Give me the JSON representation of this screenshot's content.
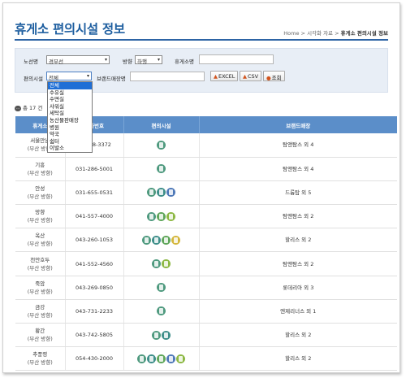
{
  "page": {
    "title": "휴게소 편의시설 정보",
    "breadcrumb": [
      "Home",
      "시각화 자료",
      "휴게소 편의시설 정보"
    ],
    "breadcrumb_sep": ">"
  },
  "search": {
    "route_label": "노선명",
    "route_value": "경부선",
    "direction_label": "방향",
    "direction_value": "하행",
    "rest_label": "휴게소명",
    "facility_label": "편의시설",
    "facility_value": "전체",
    "brand_label": "브랜드매장명",
    "excel": "EXCEL",
    "csv": "CSV",
    "search_btn": "조회",
    "arrow": "▾"
  },
  "dropdown": {
    "options": [
      "전체",
      "수유실",
      "수면실",
      "샤워실",
      "세탁실",
      "농산물판매장",
      "병원",
      "약국",
      "쉼터",
      "이발소"
    ],
    "selected": 0
  },
  "count": {
    "text": "총 17 건"
  },
  "table": {
    "headers": [
      "휴게소",
      "전화번호",
      "편의시설",
      "브랜드매장"
    ],
    "rows": [
      {
        "name": "서울만남",
        "dir": "(부산 방향)",
        "phone": "02-578-3372",
        "icons": [
          "#4f9a7f"
        ],
        "brand": "탐앤탐스 외 4"
      },
      {
        "name": "기흥",
        "dir": "(부산 방향)",
        "phone": "031-286-5001",
        "icons": [
          "#4f9a7f"
        ],
        "brand": "탐앤탐스 외 4"
      },
      {
        "name": "안성",
        "dir": "(부산 방향)",
        "phone": "031-655-0531",
        "icons": [
          "#4f9a7f",
          "#3f8f8a",
          "#4f79b8"
        ],
        "brand": "드롭탑 외 5"
      },
      {
        "name": "망향",
        "dir": "(부산 방향)",
        "phone": "041-557-4000",
        "icons": [
          "#4f9a7f",
          "#5fa65a",
          "#8db844"
        ],
        "brand": "탐앤탐스 외 2"
      },
      {
        "name": "옥산",
        "dir": "(부산 방향)",
        "phone": "043-260-1053",
        "icons": [
          "#4f9a7f",
          "#3f8f8a",
          "#5fa65a",
          "#d4b73c"
        ],
        "brand": "할리스 외 2"
      },
      {
        "name": "천안호두",
        "dir": "(부산 방향)",
        "phone": "041-552-4560",
        "icons": [
          "#4f9a7f",
          "#8db844"
        ],
        "brand": "탐앤탐스 외 2"
      },
      {
        "name": "죽암",
        "dir": "(부산 방향)",
        "phone": "043-269-0850",
        "icons": [
          "#4f9a7f"
        ],
        "brand": "롯데리아 외 3"
      },
      {
        "name": "금강",
        "dir": "(부산 방향)",
        "phone": "043-731-2233",
        "icons": [
          "#4f9a7f"
        ],
        "brand": "엔제리너스 외 1"
      },
      {
        "name": "황간",
        "dir": "(부산 방향)",
        "phone": "043-742-5805",
        "icons": [
          "#4f9a7f",
          "#3f8f8a"
        ],
        "brand": "할리스 외 2"
      },
      {
        "name": "추풍령",
        "dir": "(부산 방향)",
        "phone": "054-430-2000",
        "icons": [
          "#4f9a7f",
          "#3f8f8a",
          "#5fa65a",
          "#4f79b8",
          "#8db844"
        ],
        "brand": "할리스 외 2"
      }
    ]
  }
}
